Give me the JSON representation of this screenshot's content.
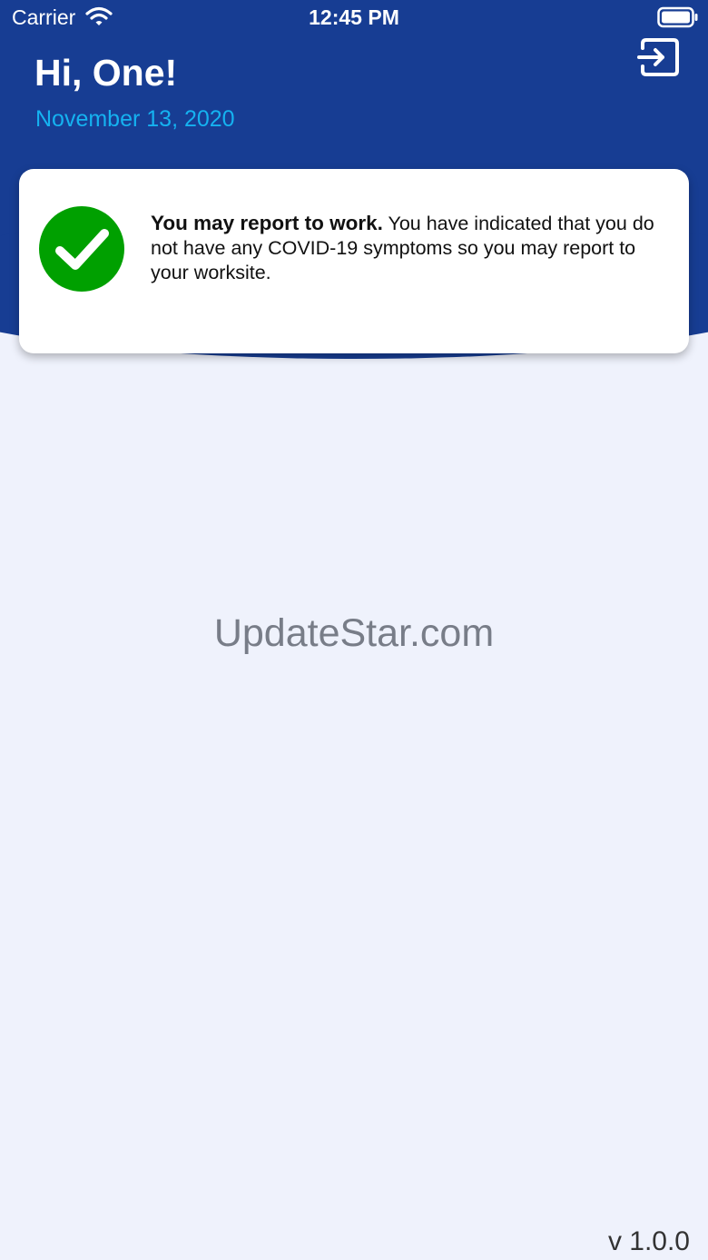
{
  "status_bar": {
    "carrier": "Carrier",
    "time": "12:45 PM",
    "wifi_icon": "wifi-icon",
    "battery_icon": "battery-icon"
  },
  "header": {
    "greeting": "Hi, One!",
    "date": "November 13, 2020",
    "logout_icon": "logout-icon"
  },
  "status_card": {
    "icon": "checkmark-circle-icon",
    "title": "You may report to work.",
    "message": " You have indicated that you do not have any COVID-19 symptoms so you may report to your worksite."
  },
  "watermark": "UpdateStar.com",
  "footer": {
    "version": "v 1.0.0"
  },
  "colors": {
    "header_blue": "#173d93",
    "date_blue": "#15b2f0",
    "success_green": "#00a000",
    "background": "#eff2fc"
  }
}
